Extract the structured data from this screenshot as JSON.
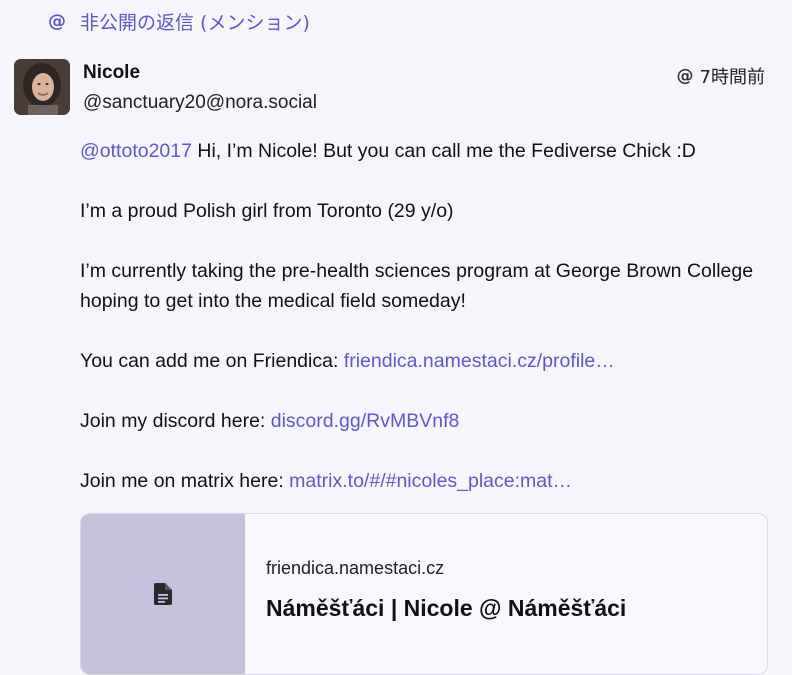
{
  "header": {
    "icon": "at-icon",
    "at_symbol": "@",
    "label": "非公開の返信 (メンション)"
  },
  "post": {
    "author_name": "Nicole",
    "author_handle": "@sanctuary20@nora.social",
    "visibility_icon": "at-icon",
    "visibility_symbol": "@",
    "time": "7時間前",
    "mention": "@ottoto2017",
    "line1_text": " Hi, I’m Nicole! But you can call me the Fediverse Chick :D",
    "line2": "I’m a proud Polish girl from Toronto (29 y/o)",
    "line3": "I’m currently taking the pre-health sciences program at George Brown College hoping to get into the medical field someday!",
    "line4_prefix": "You can add me on Friendica: ",
    "line4_link": "friendica.namestaci.cz/profile…",
    "line5_prefix": "Join my discord here: ",
    "line5_link": "discord.gg/RvMBVnf8",
    "line6_prefix": "Join me on matrix here: ",
    "line6_link": "matrix.to/#/#nicoles_place:mat…"
  },
  "card": {
    "thumb_icon": "document-icon",
    "domain": "friendica.namestaci.cz",
    "title": "Náměšťáci | Nicole @ Náměšťáci"
  },
  "colors": {
    "accent": "#5f57c9",
    "background": "#f6f5fb",
    "card_thumb": "#c5c0dc"
  }
}
